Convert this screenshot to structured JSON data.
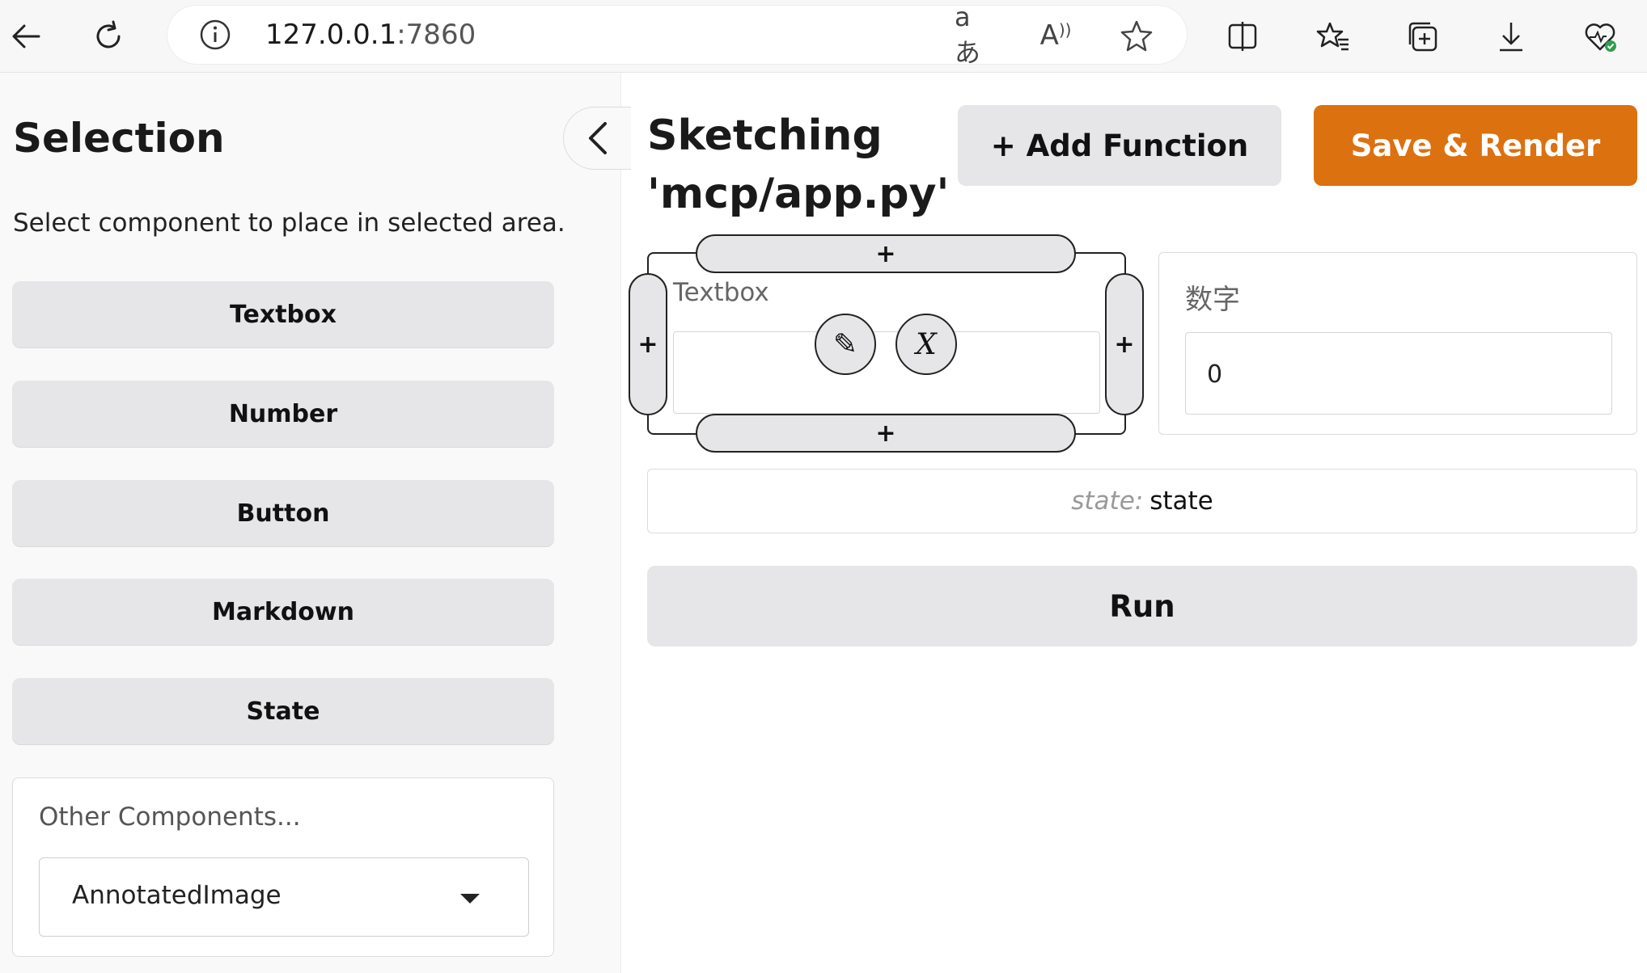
{
  "browser": {
    "url_host": "127.0.0.1",
    "url_port": ":7860",
    "read_aloud_glyph": "A",
    "translate_glyph": "aあ"
  },
  "sidebar": {
    "title": "Selection",
    "description": "Select component to place in selected area.",
    "components": [
      "Textbox",
      "Number",
      "Button",
      "Markdown",
      "State"
    ],
    "other_label": "Other Components...",
    "other_selected": "AnnotatedImage"
  },
  "main": {
    "title_line1": "Sketching",
    "title_line2": "'mcp/app.py'",
    "add_function_label": "+ Add Function",
    "save_render_label": "Save & Render",
    "textbox_label": "Textbox",
    "plus_glyph": "+",
    "edit_glyph": "✎",
    "delete_glyph": "X",
    "number_label": "数字",
    "number_value": "0",
    "state_key": "state:",
    "state_value": "state",
    "run_label": "Run"
  },
  "colors": {
    "accent": "#dc7110",
    "button_bg": "#e6e6e8",
    "sidebar_bg": "#f9f9f9"
  }
}
